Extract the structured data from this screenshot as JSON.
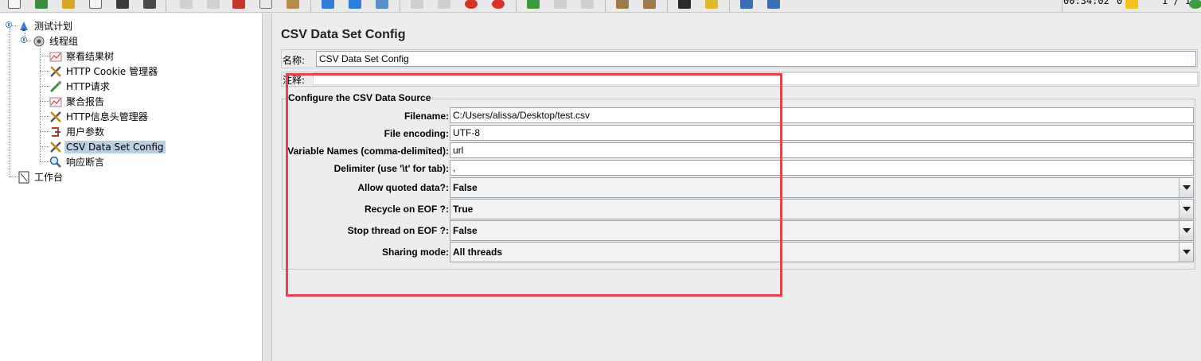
{
  "toolbar": {
    "timer": "00:34:02",
    "warning_count": "0",
    "thread_ratio": "1 / 1",
    "icons": [
      "new-icon",
      "templates-icon",
      "open-icon",
      "close-icon",
      "save-icon",
      "save-as-icon",
      "cut-icon",
      "copy-icon",
      "paste-icon",
      "expand-icon",
      "collapse-icon",
      "toggle-icon",
      "start-icon",
      "start-no-pause-icon",
      "stop-icon",
      "shutdown-icon",
      "remote-start-icon",
      "remote-stop-icon",
      "remote-shutdown-icon",
      "clear-icon",
      "clear-all-icon",
      "search-icon",
      "reset-search-icon",
      "function-helper-icon",
      "help-icon"
    ]
  },
  "tree": {
    "items": [
      {
        "label": "测试计划",
        "icon": "test-plan-icon"
      },
      {
        "label": "线程组",
        "icon": "thread-group-icon"
      },
      {
        "label": "察看结果树",
        "icon": "listener-icon"
      },
      {
        "label": "HTTP Cookie 管理器",
        "icon": "config-icon"
      },
      {
        "label": "HTTP请求",
        "icon": "sampler-icon"
      },
      {
        "label": "聚合报告",
        "icon": "listener-icon"
      },
      {
        "label": "HTTP信息头管理器",
        "icon": "config-icon"
      },
      {
        "label": "用户参数",
        "icon": "preprocessor-icon"
      },
      {
        "label": "CSV Data Set Config",
        "icon": "config-icon"
      },
      {
        "label": "响应断言",
        "icon": "assertion-icon"
      },
      {
        "label": "工作台",
        "icon": "workbench-icon"
      }
    ]
  },
  "panel": {
    "title": "CSV Data Set Config",
    "name_label": "名称:",
    "name_value": "CSV Data Set Config",
    "comment_label": "注释:",
    "comment_value": "",
    "group_title": "Configure the CSV Data Source",
    "fields": [
      {
        "label": "Filename:",
        "value": "C:/Users/alissa/Desktop/test.csv"
      },
      {
        "label": "File encoding:",
        "value": "UTF-8"
      },
      {
        "label": "Variable Names (comma-delimited):",
        "value": "url"
      },
      {
        "label": "Delimiter (use '\\t' for tab):",
        "value": ","
      }
    ],
    "selects": [
      {
        "label": "Allow quoted data?:",
        "value": "False"
      },
      {
        "label": "Recycle on EOF ?:",
        "value": "True"
      },
      {
        "label": "Stop thread on EOF ?:",
        "value": "False"
      },
      {
        "label": "Sharing mode:",
        "value": "All threads"
      }
    ]
  },
  "colors": {
    "highlight": "#e8424b",
    "selection": "#b8cfe5"
  }
}
